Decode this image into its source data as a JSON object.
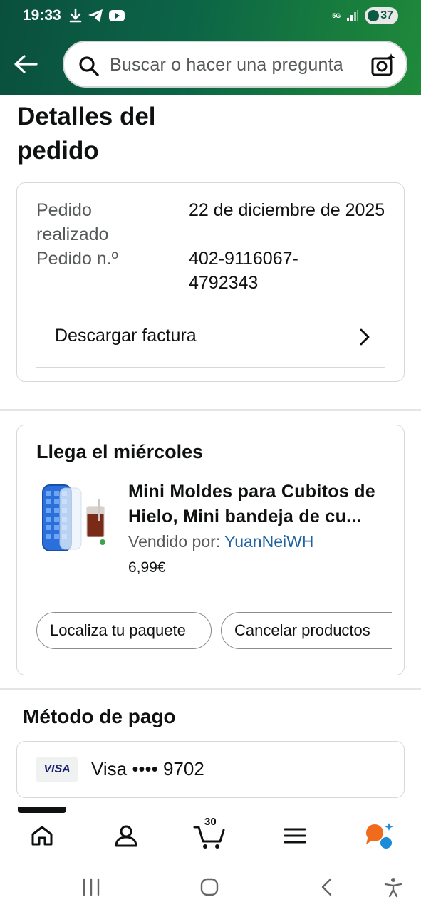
{
  "status_bar": {
    "time": "19:33",
    "network": "5G",
    "battery": "37"
  },
  "search": {
    "placeholder": "Buscar o hacer una pregunta"
  },
  "page": {
    "title": "Detalles del pedido"
  },
  "order": {
    "placed_label": "Pedido realizado",
    "placed_value": "22 de diciembre de 2025",
    "number_label": "Pedido n.º",
    "number_value": "402-9116067-4792343",
    "invoice_label": "Descargar factura"
  },
  "delivery": {
    "title": "Llega el miércoles",
    "product_title": "Mini Moldes para Cubitos de Hielo, Mini bandeja de cu...",
    "sold_by_label": "Vendido por: ",
    "seller": "YuanNeiWH",
    "price": "6,99€",
    "track_button": "Localiza tu paquete",
    "cancel_button": "Cancelar productos"
  },
  "payment": {
    "title": "Método de pago",
    "card_brand_badge": "VISA",
    "card_text": "Visa •••• 9702"
  },
  "bottom_nav": {
    "cart_count": "30"
  },
  "colors": {
    "header_green": "#0c6547",
    "link_blue": "#2162a1",
    "border": "#d5d9d9",
    "alexa_orange": "#f06b1c",
    "alexa_blue": "#1a8cd8"
  }
}
